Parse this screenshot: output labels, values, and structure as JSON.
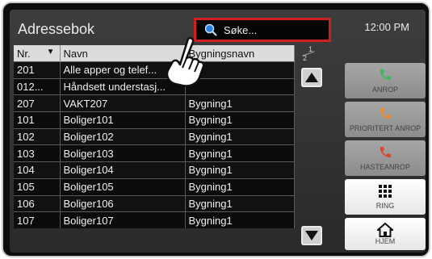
{
  "header": {
    "title": "Adressebok",
    "clock": "12:00 PM"
  },
  "search": {
    "label": "Søke..."
  },
  "table": {
    "headers": [
      "Nr.",
      "Navn",
      "Bygningsnavn"
    ],
    "rows": [
      [
        "201",
        "Alle apper og telef...",
        ""
      ],
      [
        "012...",
        "Håndsett understasj...",
        ""
      ],
      [
        "207",
        "VAKT207",
        "Bygning1"
      ],
      [
        "101",
        "Boliger101",
        "Bygning1"
      ],
      [
        "102",
        "Boliger102",
        "Bygning1"
      ],
      [
        "103",
        "Boliger103",
        "Bygning1"
      ],
      [
        "104",
        "Boliger104",
        "Bygning1"
      ],
      [
        "105",
        "Boliger105",
        "Bygning1"
      ],
      [
        "106",
        "Boliger106",
        "Bygning1"
      ],
      [
        "107",
        "Boliger107",
        "Bygning1"
      ]
    ]
  },
  "pager": {
    "current": "1",
    "total": "2"
  },
  "sidebar": {
    "buttons": [
      {
        "label": "ANROP",
        "icon": "phone-green-icon",
        "color": "#3dbb5a"
      },
      {
        "label": "PRIORITERT ANROP",
        "icon": "phone-orange-icon",
        "color": "#f08a24"
      },
      {
        "label": "HASTEANROP",
        "icon": "phone-red-icon",
        "color": "#e0452c"
      },
      {
        "label": "RING",
        "icon": "keypad-icon"
      },
      {
        "label": "HJEM",
        "icon": "home-icon"
      }
    ]
  },
  "colors": {
    "highlight": "#d01f1f"
  }
}
